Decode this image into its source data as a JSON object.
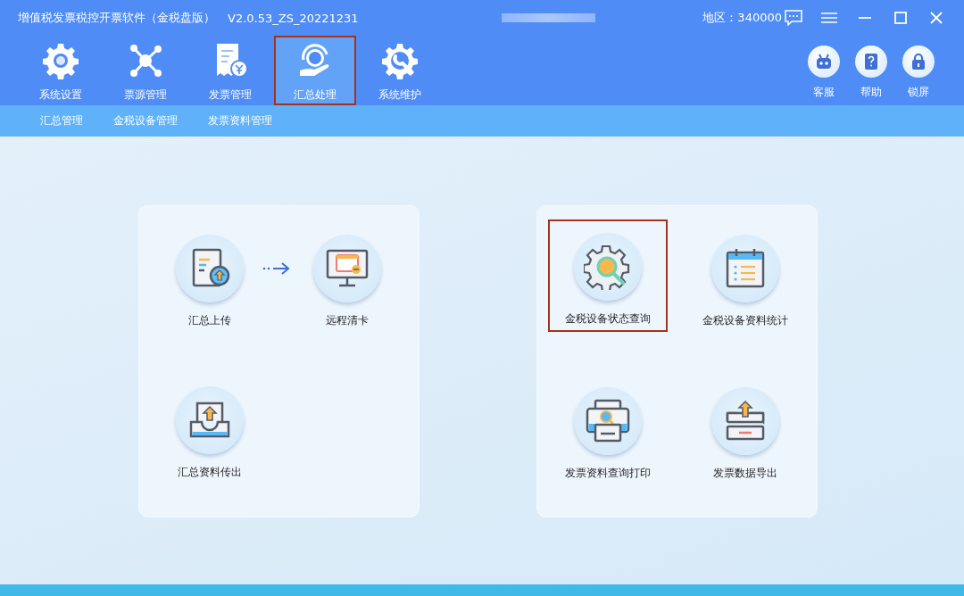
{
  "window": {
    "title": "增值税发票税控开票软件（金税盘版）",
    "version": "V2.0.53_ZS_20221231",
    "region": "地区：340000"
  },
  "tabs": [
    {
      "label": "系统设置",
      "selected": false
    },
    {
      "label": "票源管理",
      "selected": false
    },
    {
      "label": "发票管理",
      "selected": false
    },
    {
      "label": "汇总处理",
      "selected": true
    },
    {
      "label": "系统维护",
      "selected": false
    }
  ],
  "tools": [
    {
      "label": "客服"
    },
    {
      "label": "帮助"
    },
    {
      "label": "锁屏"
    }
  ],
  "subnav": [
    {
      "label": "汇总管理"
    },
    {
      "label": "金税设备管理"
    },
    {
      "label": "发票资料管理"
    }
  ],
  "panels": [
    {
      "tiles": [
        {
          "kind": "upload",
          "label": "汇总上传",
          "highlighted": false,
          "arrow_after": true
        },
        {
          "kind": "remote-clear",
          "label": "远程清卡",
          "highlighted": false,
          "arrow_after": false
        },
        {
          "kind": "export",
          "label": "汇总资料传出",
          "highlighted": false,
          "arrow_after": false
        }
      ]
    },
    {
      "tiles": [
        {
          "kind": "status-query",
          "label": "金税设备状态查询",
          "highlighted": true,
          "arrow_after": false
        },
        {
          "kind": "statistics",
          "label": "金税设备资料统计",
          "highlighted": false,
          "arrow_after": false
        },
        {
          "kind": "print",
          "label": "发票资料查询打印",
          "highlighted": false,
          "arrow_after": false
        },
        {
          "kind": "data-export",
          "label": "发票数据导出",
          "highlighted": false,
          "arrow_after": false
        }
      ]
    }
  ]
}
